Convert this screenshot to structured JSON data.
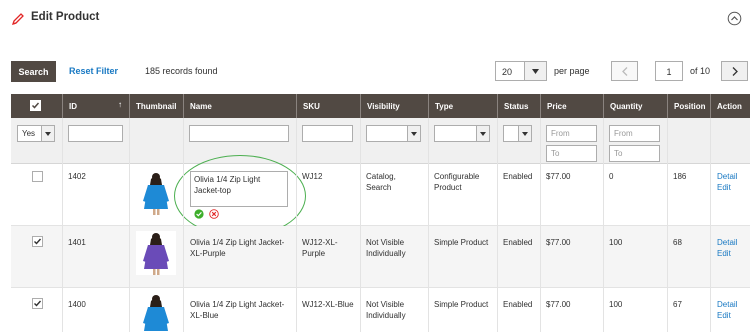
{
  "header": {
    "title": "Edit Product"
  },
  "toolbar": {
    "search_label": "Search",
    "reset_label": "Reset Filter",
    "records_text": "185 records found",
    "per_page_value": "20",
    "per_page_label": "per page",
    "current_page": "1",
    "page_of": "of 10"
  },
  "columns": [
    "ID",
    "Thumbnail",
    "Name",
    "SKU",
    "Visibility",
    "Type",
    "Status",
    "Price",
    "Quantity",
    "Position",
    "Action"
  ],
  "filters": {
    "select_value": "Yes",
    "price_from": "From",
    "price_to": "To",
    "qty_from": "From",
    "qty_to": "To"
  },
  "rows": [
    {
      "id": "1402",
      "checked": false,
      "thumb_color": "#1e8ad6",
      "name": "Olivia 1/4 Zip Light Jacket-top",
      "editing": true,
      "sku": "WJ12",
      "visibility": "Catalog, Search",
      "type": "Configurable Product",
      "status": "Enabled",
      "price": "$77.00",
      "quantity": "0",
      "position": "186",
      "action_detail": "Detail",
      "action_edit": "Edit"
    },
    {
      "id": "1401",
      "checked": true,
      "thumb_color": "#6a4bb8",
      "name": "Olivia 1/4 Zip Light Jacket-XL-Purple",
      "editing": false,
      "sku": "WJ12-XL-Purple",
      "visibility": "Not Visible Individually",
      "type": "Simple Product",
      "status": "Enabled",
      "price": "$77.00",
      "quantity": "100",
      "position": "68",
      "action_detail": "Detail",
      "action_edit": "Edit"
    },
    {
      "id": "1400",
      "checked": true,
      "thumb_color": "#1e8ad6",
      "name": "Olivia 1/4 Zip Light Jacket-XL-Blue",
      "editing": false,
      "sku": "WJ12-XL-Blue",
      "visibility": "Not Visible Individually",
      "type": "Simple Product",
      "status": "Enabled",
      "price": "$77.00",
      "quantity": "100",
      "position": "67",
      "action_detail": "Detail",
      "action_edit": "Edit"
    }
  ],
  "colors": {
    "header_bg": "#514943",
    "link": "#1979c3",
    "ok": "#3dae2b",
    "cancel": "#e22626",
    "highlight": "#4caf50"
  },
  "icons": [
    "pencil-icon",
    "collapse-icon",
    "chevron-down-icon",
    "chevron-left-icon",
    "chevron-right-icon",
    "sort-arrow-icon",
    "checkbox-icon",
    "ok-icon",
    "cancel-icon"
  ]
}
